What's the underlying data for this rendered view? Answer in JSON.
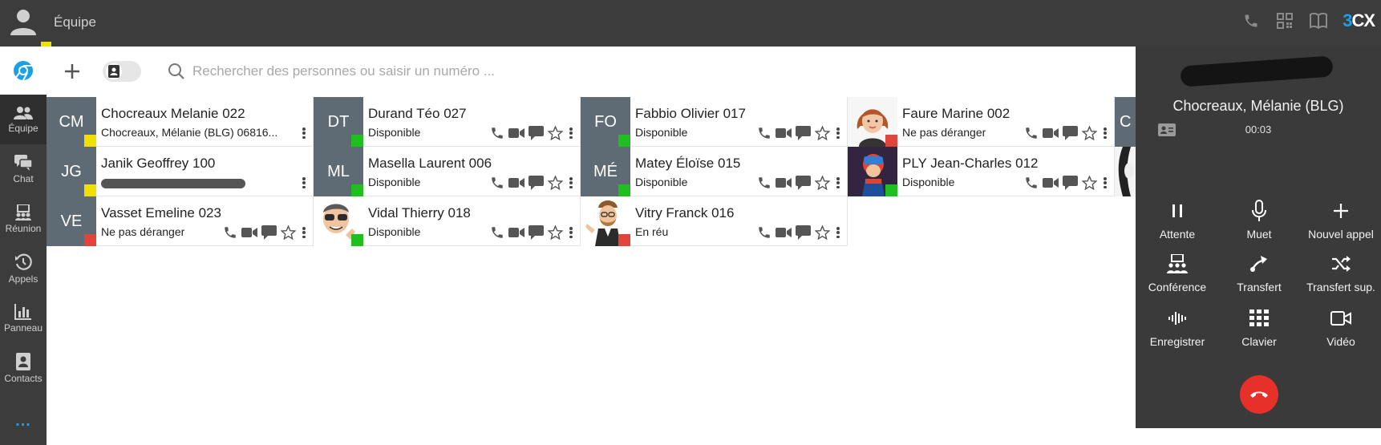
{
  "header": {
    "title": "Équipe",
    "logo": {
      "prefix": "3",
      "suffix": "CX"
    },
    "icons": [
      "phone-icon",
      "qr-code-icon",
      "book-icon"
    ]
  },
  "nav": {
    "items": [
      {
        "label": "Équipe",
        "icon": "team-icon"
      },
      {
        "label": "Chat",
        "icon": "chat-icon"
      },
      {
        "label": "Réunion",
        "icon": "meeting-icon"
      },
      {
        "label": "Appels",
        "icon": "history-icon"
      },
      {
        "label": "Panneau",
        "icon": "panel-chart-icon"
      },
      {
        "label": "Contacts",
        "icon": "contacts-icon"
      }
    ],
    "more": "..."
  },
  "toolbar": {
    "search_placeholder": "Rechercher des personnes ou saisir un numéro ..."
  },
  "colors": {
    "available": "#1fbf1f",
    "dnd": "#e0443a",
    "away": "#f0e000",
    "accent": "#1aa0e6",
    "hangup": "#e8302a"
  },
  "contacts": [
    {
      "initials": "CM",
      "name": "Chocreaux Melanie 022",
      "status": "Chocreaux, Mélanie (BLG) 06816...",
      "state": "away"
    },
    {
      "initials": "DT",
      "name": "Durand Téo 027",
      "status": "Disponible",
      "state": "available"
    },
    {
      "initials": "FO",
      "name": "Fabbio Olivier 017",
      "status": "Disponible",
      "state": "available"
    },
    {
      "initials": "",
      "name": "Faure Marine 002",
      "status": "Ne pas déranger",
      "state": "dnd"
    },
    {
      "initials": "JG",
      "name": "Janik Geoffrey 100",
      "status": "",
      "state": "away"
    },
    {
      "initials": "ML",
      "name": "Masella Laurent 006",
      "status": "Disponible",
      "state": "available"
    },
    {
      "initials": "MÉ",
      "name": "Matey Éloïse 015",
      "status": "Disponible",
      "state": "available"
    },
    {
      "initials": "",
      "name": "PLY Jean-Charles 012",
      "status": "Disponible",
      "state": "available"
    },
    {
      "initials": "VE",
      "name": "Vasset Emeline 023",
      "status": "Ne pas déranger",
      "state": "dnd"
    },
    {
      "initials": "",
      "name": "Vidal Thierry 018",
      "status": "Disponible",
      "state": "available"
    },
    {
      "initials": "",
      "name": "Vitry Franck 016",
      "status": "En réu",
      "state": "dnd"
    }
  ],
  "call": {
    "caller": "Chocreaux, Mélanie (BLG)",
    "timer": "00:03",
    "buttons": [
      {
        "label": "Attente",
        "icon": "pause-icon"
      },
      {
        "label": "Muet",
        "icon": "microphone-icon"
      },
      {
        "label": "Nouvel appel",
        "icon": "plus-icon"
      },
      {
        "label": "Conférence",
        "icon": "conference-icon"
      },
      {
        "label": "Transfert",
        "icon": "transfer-icon"
      },
      {
        "label": "Transfert sup.",
        "icon": "shuffle-icon"
      },
      {
        "label": "Enregistrer",
        "icon": "record-waveform-icon"
      },
      {
        "label": "Clavier",
        "icon": "dialpad-icon"
      },
      {
        "label": "Vidéo",
        "icon": "video-icon"
      }
    ]
  }
}
